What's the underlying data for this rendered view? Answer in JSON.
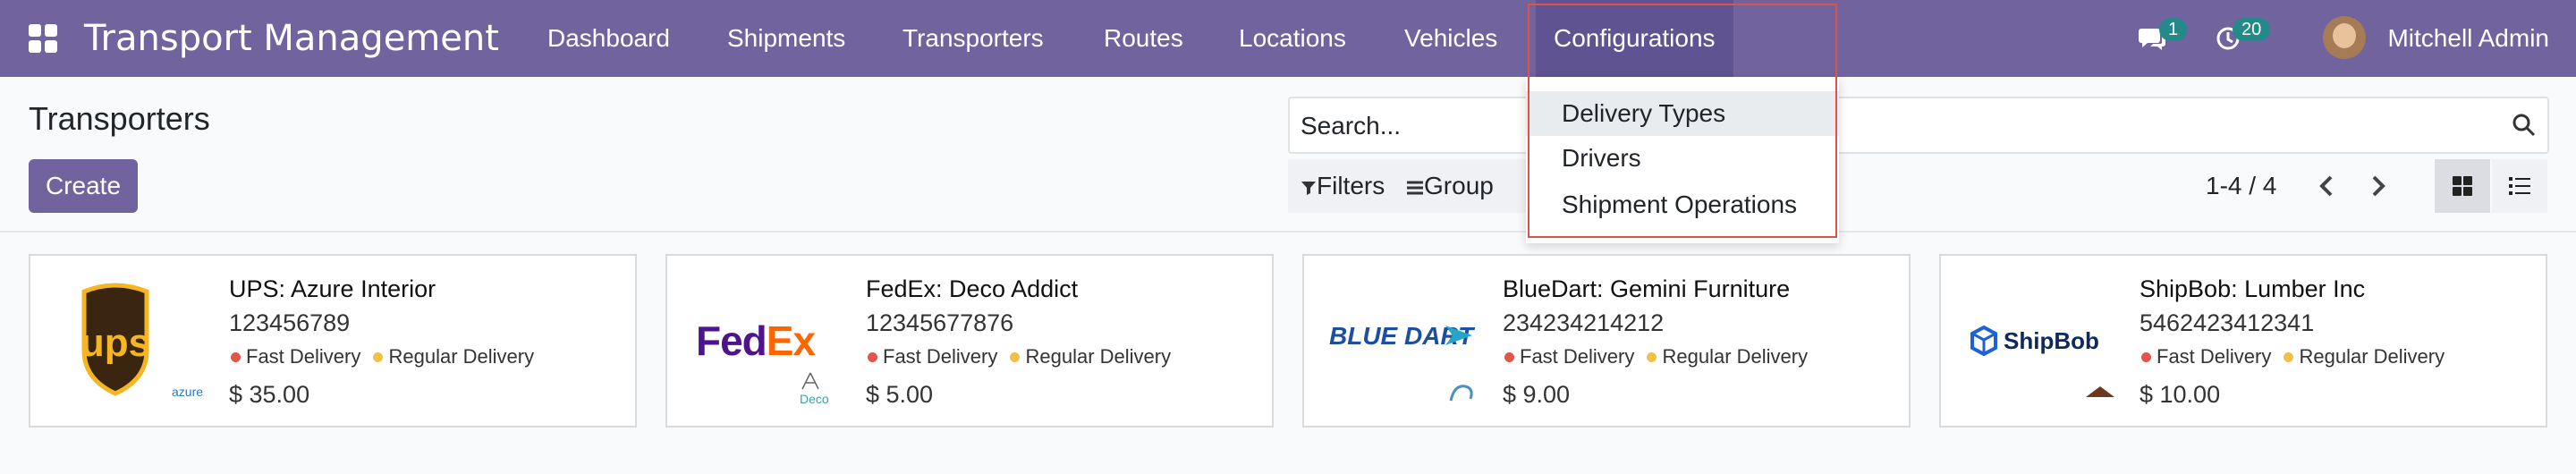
{
  "navbar": {
    "brand": "Transport Management",
    "menus": [
      "Dashboard",
      "Shipments",
      "Transporters",
      "Routes",
      "Locations",
      "Vehicles",
      "Configurations"
    ],
    "messages_count": "1",
    "activities_count": "20",
    "user_name": "Mitchell Admin"
  },
  "dropdown": {
    "items": [
      "Delivery Types",
      "Drivers",
      "Shipment Operations"
    ]
  },
  "control_panel": {
    "title": "Transporters",
    "create_label": "Create",
    "search_placeholder": "Search...",
    "filters_label": "Filters",
    "group_label": "Group",
    "pager": "1-4 / 4"
  },
  "cards": [
    {
      "name": "UPS: Azure Interior",
      "number": "123456789",
      "tag1": "Fast Delivery",
      "tag2": "Regular Delivery",
      "price": "$ 35.00",
      "logo_text": "ups",
      "sub_logo": "azure"
    },
    {
      "name": "FedEx: Deco Addict",
      "number": "12345677876",
      "tag1": "Fast Delivery",
      "tag2": "Regular Delivery",
      "price": "$ 5.00",
      "logo_text_a": "Fed",
      "logo_text_b": "Ex",
      "sub_logo": "Deco"
    },
    {
      "name": "BlueDart: Gemini Furniture",
      "number": "234234214212",
      "tag1": "Fast Delivery",
      "tag2": "Regular Delivery",
      "price": "$ 9.00",
      "logo_text": "BLUE DART"
    },
    {
      "name": "ShipBob: Lumber Inc",
      "number": "5462423412341",
      "tag1": "Fast Delivery",
      "tag2": "Regular Delivery",
      "price": "$ 10.00",
      "logo_text": "ShipBob"
    }
  ],
  "colors": {
    "navbar": "#71639e",
    "fast_delivery": "#e0564b",
    "regular_delivery": "#f0c04a"
  }
}
